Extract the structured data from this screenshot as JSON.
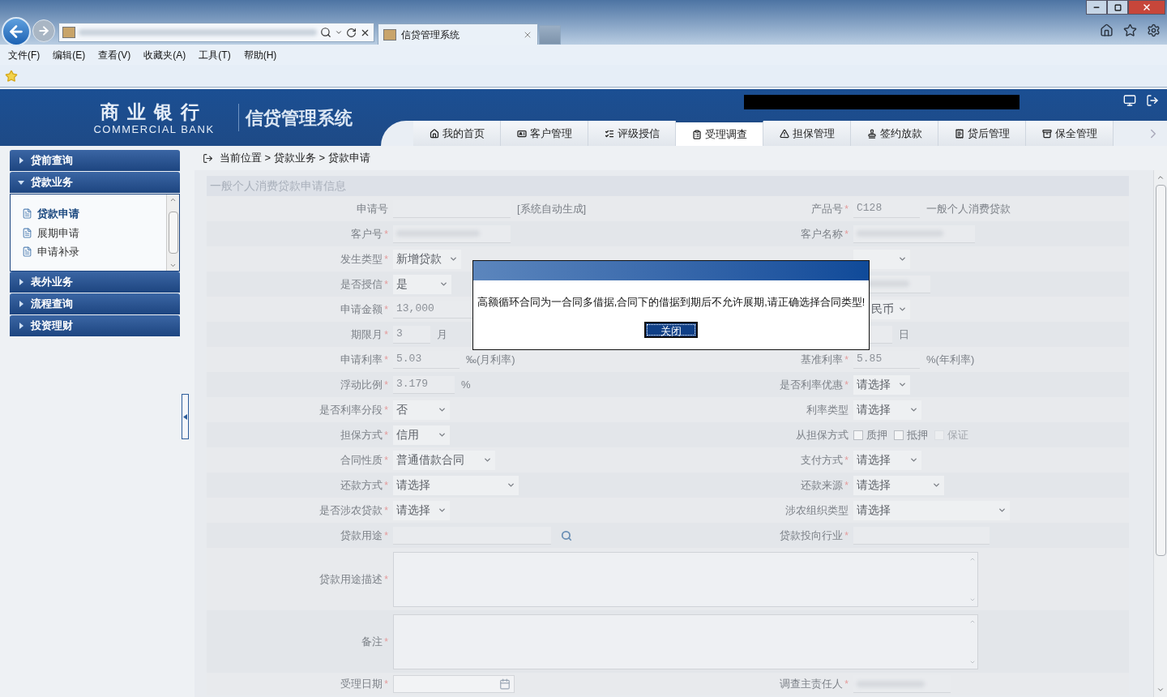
{
  "browser": {
    "tab_title": "信贷管理系统",
    "menu": [
      "文件(F)",
      "编辑(E)",
      "查看(V)",
      "收藏夹(A)",
      "工具(T)",
      "帮助(H)"
    ]
  },
  "header": {
    "brand_cn": "商业银行",
    "brand_en": "COMMERCIAL BANK",
    "system": "信贷管理系统",
    "nav": [
      {
        "label": "我的首页",
        "selected": false
      },
      {
        "label": "客户管理",
        "selected": false
      },
      {
        "label": "评级授信",
        "selected": false
      },
      {
        "label": "受理调查",
        "selected": true
      },
      {
        "label": "担保管理",
        "selected": false
      },
      {
        "label": "签约放款",
        "selected": false
      },
      {
        "label": "贷后管理",
        "selected": false
      },
      {
        "label": "保全管理",
        "selected": false
      }
    ]
  },
  "sidebar": {
    "groups": [
      {
        "label": "贷前查询",
        "expanded": false
      },
      {
        "label": "贷款业务",
        "expanded": true,
        "items": [
          {
            "label": "贷款申请",
            "selected": true
          },
          {
            "label": "展期申请",
            "selected": false
          },
          {
            "label": "申请补录",
            "selected": false
          }
        ]
      },
      {
        "label": "表外业务",
        "expanded": false
      },
      {
        "label": "流程查询",
        "expanded": false
      },
      {
        "label": "投资理财",
        "expanded": false
      }
    ]
  },
  "breadcrumb": "当前位置 > 贷款业务 > 贷款申请",
  "form": {
    "title": "一般个人消费贷款申请信息",
    "rows": [
      {
        "left": {
          "label": "申请号",
          "kind": "text",
          "suffix": "[系统自动生成]"
        },
        "right": {
          "label": "产品号",
          "mark": "*",
          "kind": "text",
          "value": "C128",
          "suffix": "一般个人消费贷款"
        }
      },
      {
        "left": {
          "label": "客户号",
          "mark": "*",
          "kind": "text",
          "masked": true
        },
        "right": {
          "label": "客户名称",
          "mark": "*",
          "kind": "text",
          "masked": true
        }
      },
      {
        "left": {
          "label": "发生类型",
          "mark": "*",
          "kind": "select",
          "value": "新增贷款"
        },
        "right": {
          "kind": "select"
        }
      },
      {
        "left": {
          "label": "是否授信",
          "mark": "*",
          "kind": "select",
          "value": "是"
        },
        "right": {
          "kind": "text",
          "masked": true
        }
      },
      {
        "left": {
          "label": "申请金额",
          "mark": "*",
          "kind": "text",
          "value": "13,000"
        },
        "right": {
          "kind": "select",
          "value": "民币"
        }
      },
      {
        "left": {
          "label": "期限月",
          "mark": "*",
          "kind": "text",
          "value": "3",
          "suffix": "月"
        },
        "right": {
          "kind": "text",
          "suffix": "日"
        }
      },
      {
        "left": {
          "label": "申请利率",
          "mark": "*",
          "kind": "text",
          "value": "5.03",
          "suffix": "‰(月利率)"
        },
        "right": {
          "label": "基准利率",
          "mark": "*",
          "kind": "text",
          "value": "5.85",
          "suffix": "%(年利率)"
        }
      },
      {
        "left": {
          "label": "浮动比例",
          "mark": "*",
          "kind": "text",
          "value": "3.179",
          "suffix": "%"
        },
        "right": {
          "label": "是否利率优惠",
          "mark": "*",
          "kind": "select",
          "value": "请选择"
        }
      },
      {
        "left": {
          "label": "是否利率分段",
          "mark": "*",
          "kind": "select",
          "value": "否"
        },
        "right": {
          "label": "利率类型",
          "kind": "select",
          "value": "请选择"
        }
      },
      {
        "left": {
          "label": "担保方式",
          "mark": "*",
          "kind": "select",
          "value": "信用"
        },
        "right": {
          "label": "从担保方式",
          "kind": "checks",
          "options": [
            {
              "label": "质押",
              "checked": false,
              "disabled": false
            },
            {
              "label": "抵押",
              "checked": false,
              "disabled": false
            },
            {
              "label": "保证",
              "checked": false,
              "disabled": true
            }
          ]
        }
      },
      {
        "left": {
          "label": "合同性质",
          "mark": "*",
          "kind": "select",
          "value": "普通借款合同"
        },
        "right": {
          "label": "支付方式",
          "mark": "*",
          "kind": "select",
          "value": "请选择"
        }
      },
      {
        "left": {
          "label": "还款方式",
          "mark": "*",
          "kind": "select",
          "value": "请选择"
        },
        "right": {
          "label": "还款来源",
          "mark": "*",
          "kind": "select",
          "value": "请选择"
        }
      },
      {
        "left": {
          "label": "是否涉农贷款",
          "mark": "*",
          "kind": "select",
          "value": "请选择"
        },
        "right": {
          "label": "涉农组织类型",
          "kind": "select",
          "value": "请选择"
        }
      },
      {
        "left": {
          "label": "贷款用途",
          "mark": "*",
          "kind": "search"
        },
        "right": {
          "label": "贷款投向行业",
          "mark": "*",
          "kind": "text"
        }
      },
      {
        "full": {
          "label": "贷款用途描述",
          "mark": "*",
          "kind": "textarea"
        }
      },
      {
        "full": {
          "label": "备注",
          "mark": "*",
          "kind": "textarea"
        }
      },
      {
        "left": {
          "label": "受理日期",
          "mark": "*",
          "kind": "date"
        },
        "right": {
          "label": "调查主责任人",
          "mark": "*",
          "kind": "text",
          "masked": true
        }
      }
    ]
  },
  "dialog": {
    "message": "高额循环合同为一合同多借据,合同下的借据到期后不允许展期,请正确选择合同类型!",
    "button": "关闭"
  }
}
